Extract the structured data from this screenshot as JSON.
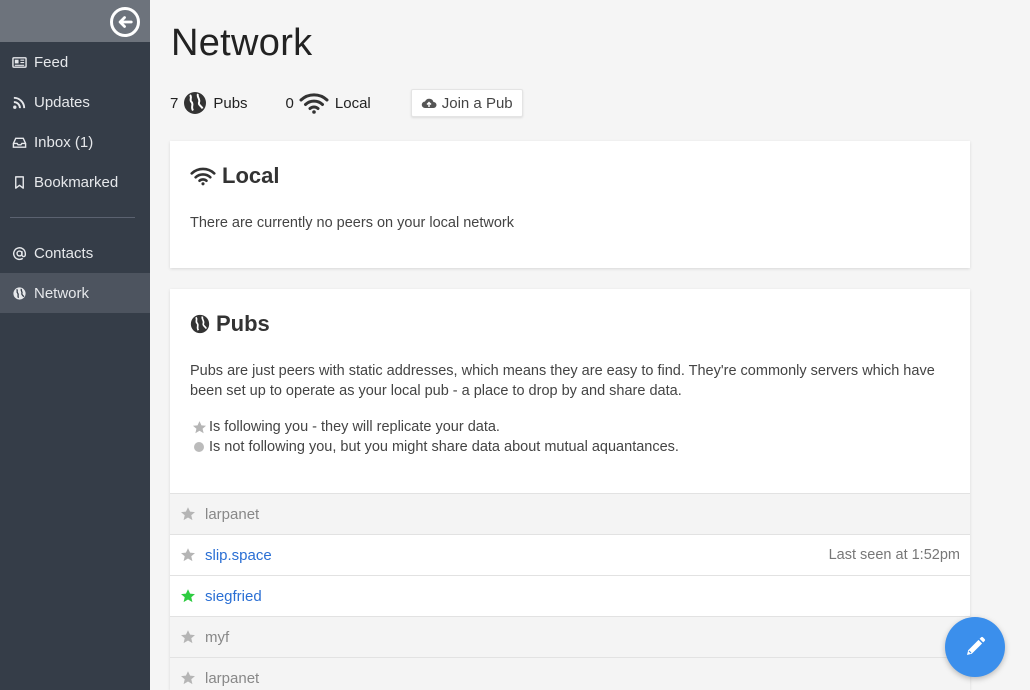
{
  "sidebar": {
    "items": [
      {
        "label": "Feed",
        "icon": "newspaper-icon"
      },
      {
        "label": "Updates",
        "icon": "rss-icon"
      },
      {
        "label": "Inbox (1)",
        "icon": "inbox-icon"
      },
      {
        "label": "Bookmarked",
        "icon": "bookmark-icon"
      },
      {
        "label": "Contacts",
        "icon": "at-icon"
      },
      {
        "label": "Network",
        "icon": "globe-icon",
        "active": true
      }
    ]
  },
  "main": {
    "title": "Network",
    "stats": {
      "pubs_count": "7",
      "pubs_label": "Pubs",
      "local_count": "0",
      "local_label": "Local",
      "join_label": "Join a Pub"
    },
    "local_card": {
      "title": "Local",
      "text": "There are currently no peers on your local network"
    },
    "pubs_card": {
      "title": "Pubs",
      "text": "Pubs are just peers with static addresses, which means they are easy to find. They're commonly servers which have been set up to operate as your local pub - a place to drop by and share data.",
      "legend_following": "Is following you - they will replicate your data.",
      "legend_not_following": "Is not following you, but you might share data about mutual aquantances."
    },
    "peers": [
      {
        "name": "larpanet",
        "style": "gray",
        "star_color": "#b5b5b5",
        "last_seen": ""
      },
      {
        "name": "slip.space",
        "style": "white",
        "star_color": "#b5b5b5",
        "last_seen": "Last seen at 1:52pm"
      },
      {
        "name": "siegfried",
        "style": "white",
        "star_color": "#2ecc40",
        "last_seen": ""
      },
      {
        "name": "myf",
        "style": "gray",
        "star_color": "#b5b5b5",
        "last_seen": ""
      },
      {
        "name": "larpanet",
        "style": "gray",
        "star_color": "#b5b5b5",
        "last_seen": ""
      }
    ]
  },
  "colors": {
    "sidebar_bg": "#353d48",
    "accent": "#3b8fec",
    "link": "#2a6fd4",
    "following_star": "#2ecc40"
  }
}
